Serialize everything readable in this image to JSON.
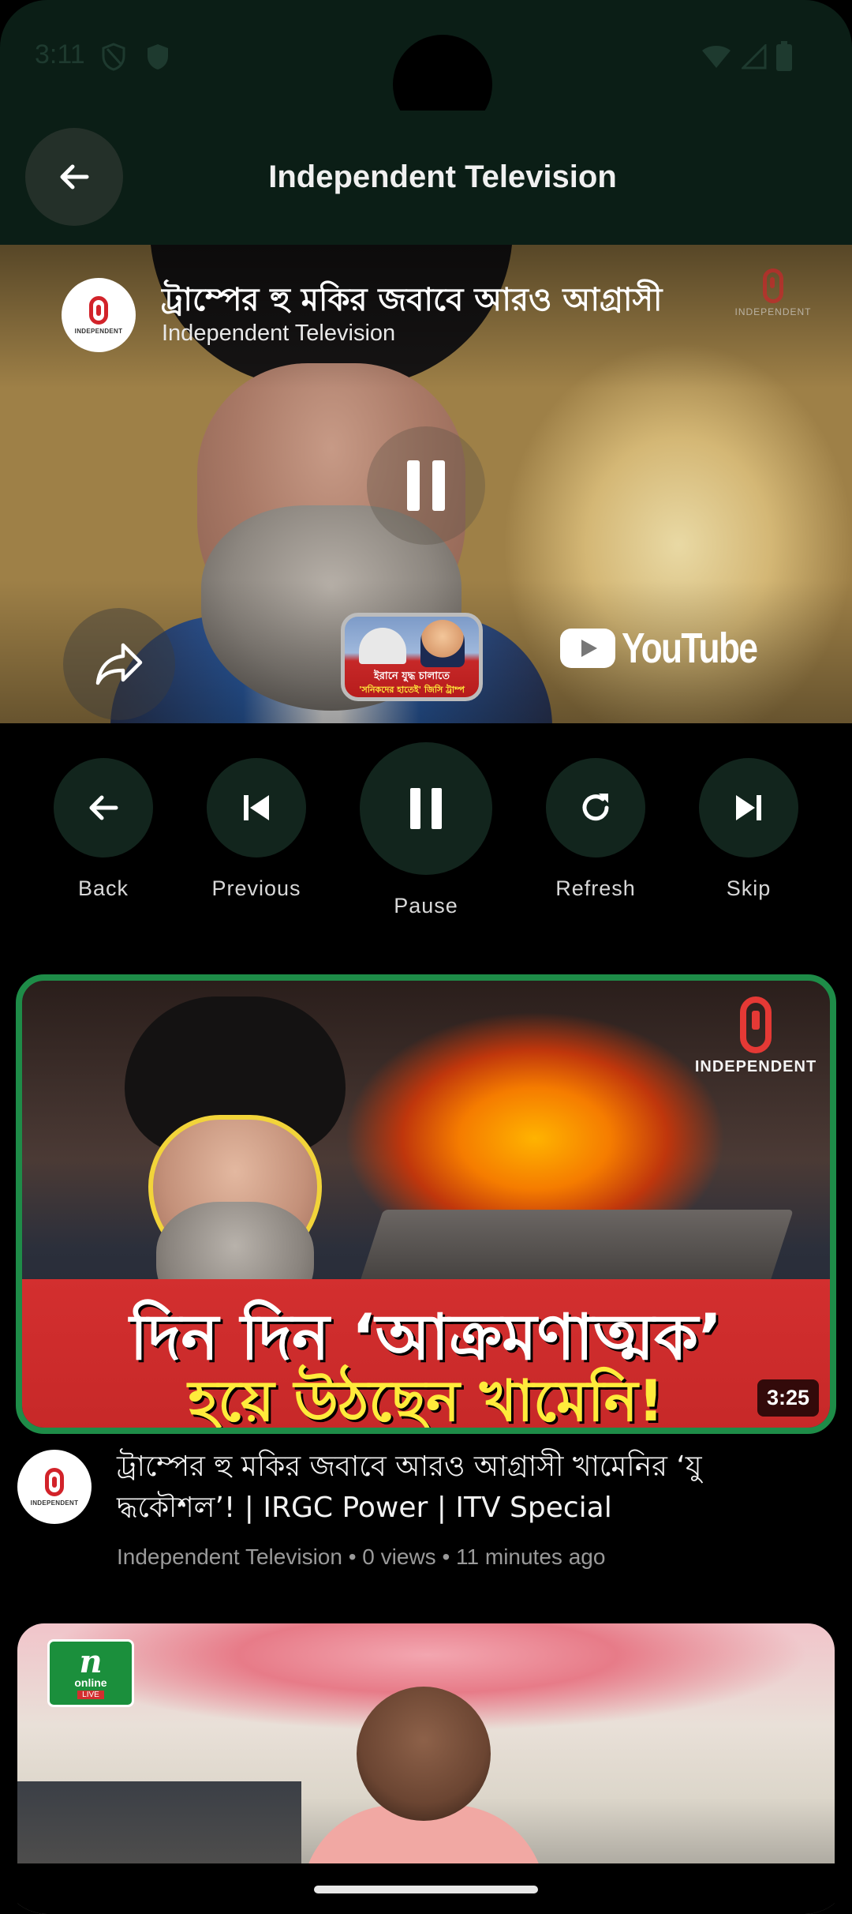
{
  "status_bar": {
    "time": "3:11"
  },
  "app_bar": {
    "title": "Independent Television"
  },
  "player": {
    "video_title": "ট্রাম্পের হু মকির জবাবে আরও আগ্রাসী",
    "channel_name": "Independent Television",
    "avatar_text": "INDEPENDENT",
    "watermark_text": "INDEPENDENT",
    "up_next_line1": "ইরানে যুদ্ধ চালাতে",
    "up_next_line2": "'সনিকদের হাতেই' জিসি ট্রাম্প",
    "youtube_wordmark": "YouTube"
  },
  "controls": [
    {
      "label": "Back",
      "icon": "arrow-left-icon"
    },
    {
      "label": "Previous",
      "icon": "skip-previous-icon"
    },
    {
      "label": "Pause",
      "icon": "pause-icon"
    },
    {
      "label": "Refresh",
      "icon": "refresh-icon"
    },
    {
      "label": "Skip",
      "icon": "skip-next-icon"
    }
  ],
  "feed": [
    {
      "thumb_line1": "দিন দিন ‘আক্রমণাত্মক’",
      "thumb_line2": "হয়ে উঠছেন খামেনি!",
      "thumb_watermark": "INDEPENDENT",
      "duration": "3:25",
      "avatar_text": "INDEPENDENT",
      "title": "ট্রাম্পের হু মকির জবাবে আরও আগ্রাসী খামেনির ‘যু দ্ধকৌশল’! | IRGC Power | ITV Special",
      "meta": "Independent Television • 0 views • 11 minutes ago"
    },
    {
      "logo_n": "n",
      "logo_sub": "online",
      "logo_live": "LIVE"
    }
  ],
  "colors": {
    "header_bg": "#0b1e16",
    "control_bg": "#12251d",
    "active_border": "#1e8c48",
    "brand_red": "#d2232a"
  }
}
